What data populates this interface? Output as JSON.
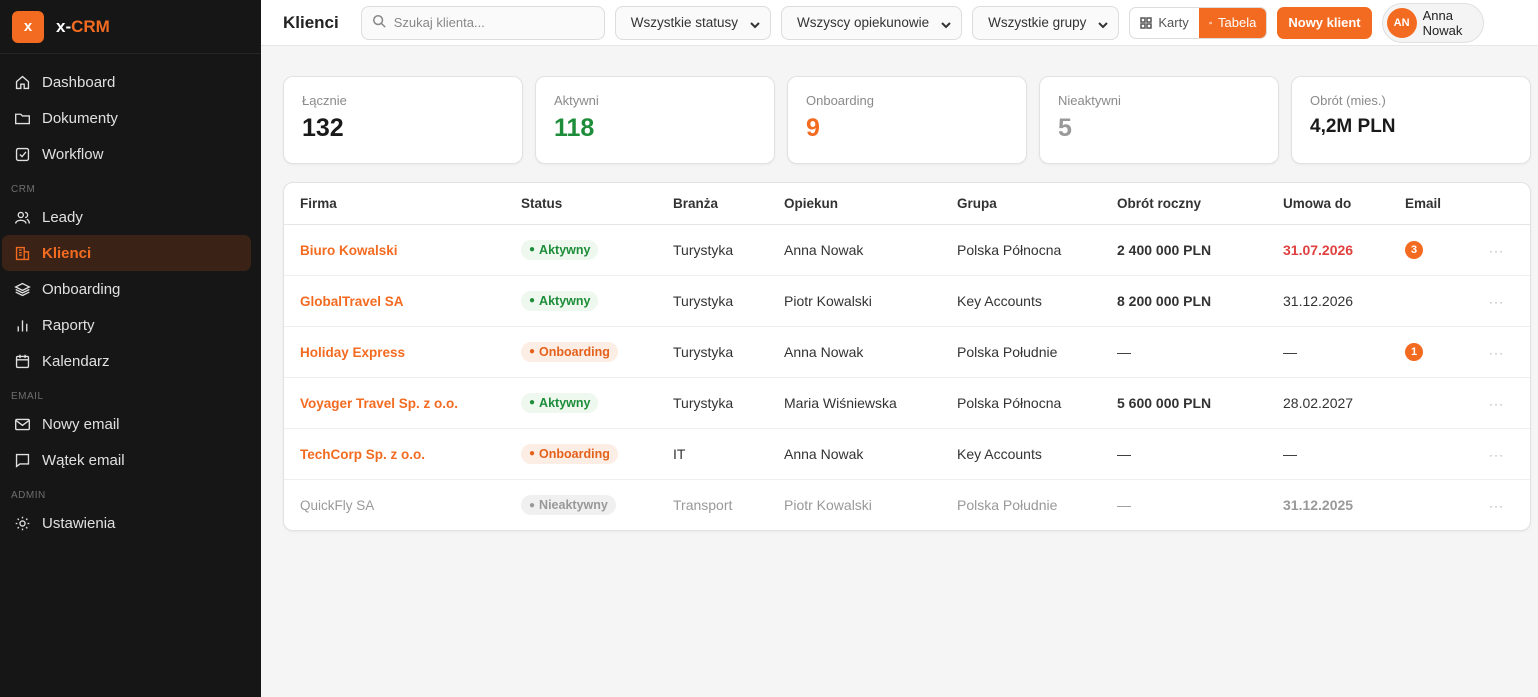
{
  "brand": {
    "logo": "x",
    "name_prefix": "x-",
    "name_accent": "CRM"
  },
  "sidebar": {
    "main_items": [
      {
        "label": "Dashboard",
        "icon": "home-icon"
      },
      {
        "label": "Dokumenty",
        "icon": "folder-icon"
      },
      {
        "label": "Workflow",
        "icon": "checkbox-icon"
      }
    ],
    "sections": {
      "crm": "CRM",
      "email": "EMAIL",
      "admin": "ADMIN"
    },
    "crm_items": [
      {
        "label": "Leady",
        "icon": "users-icon"
      },
      {
        "label": "Klienci",
        "icon": "building-icon"
      },
      {
        "label": "Onboarding",
        "icon": "layers-icon"
      },
      {
        "label": "Raporty",
        "icon": "bar-chart-icon"
      },
      {
        "label": "Kalendarz",
        "icon": "calendar-icon"
      }
    ],
    "email_items": [
      {
        "label": "Nowy email",
        "icon": "mail-icon"
      },
      {
        "label": "Wątek email",
        "icon": "message-icon"
      }
    ],
    "admin_items": [
      {
        "label": "Ustawienia",
        "icon": "gear-icon"
      }
    ]
  },
  "header": {
    "title": "Klienci",
    "search_placeholder": "Szukaj klienta...",
    "filter_status": "Wszystkie statusy",
    "filter_owner": "Wszyscy opiekunowie",
    "filter_group": "Wszystkie grupy",
    "view_cards": "Karty",
    "view_table": "Tabela",
    "new_client": "Nowy klient",
    "user_initials": "AN",
    "user_first": "Anna",
    "user_last": "Nowak"
  },
  "stats": [
    {
      "label": "Łącznie",
      "value": "132",
      "color": "#1a1a1a"
    },
    {
      "label": "Aktywni",
      "value": "118",
      "color": "#1d8d3a"
    },
    {
      "label": "Onboarding",
      "value": "9",
      "color": "#f36b21"
    },
    {
      "label": "Nieaktywni",
      "value": "5",
      "color": "#999999"
    },
    {
      "label": "Obrót (mies.)",
      "value": "4,2M PLN",
      "color": "#1a1a1a"
    }
  ],
  "table": {
    "headers": [
      "Firma",
      "Status",
      "Branża",
      "Opiekun",
      "Grupa",
      "Obrót roczny",
      "Umowa do",
      "Email",
      ""
    ],
    "rows": [
      {
        "firm": "Biuro Kowalski",
        "status": "Aktywny",
        "status_type": "green",
        "industry": "Turystyka",
        "owner": "Anna Nowak",
        "group": "Polska Północna",
        "turnover": "2 400 000 PLN",
        "contract": "31.07.2026",
        "contract_red": true,
        "email": "3"
      },
      {
        "firm": "GlobalTravel SA",
        "status": "Aktywny",
        "status_type": "green",
        "industry": "Turystyka",
        "owner": "Piotr Kowalski",
        "group": "Key Accounts",
        "turnover": "8 200 000 PLN",
        "contract": "31.12.2026",
        "contract_red": false,
        "email": ""
      },
      {
        "firm": "Holiday Express",
        "status": "Onboarding",
        "status_type": "orange",
        "industry": "Turystyka",
        "owner": "Anna Nowak",
        "group": "Polska Południe",
        "turnover": "—",
        "contract": "—",
        "contract_red": false,
        "email": "1"
      },
      {
        "firm": "Voyager Travel Sp. z o.o.",
        "status": "Aktywny",
        "status_type": "green",
        "industry": "Turystyka",
        "owner": "Maria Wiśniewska",
        "group": "Polska Północna",
        "turnover": "5 600 000 PLN",
        "contract": "28.02.2027",
        "contract_red": false,
        "email": ""
      },
      {
        "firm": "TechCorp Sp. z o.o.",
        "status": "Onboarding",
        "status_type": "orange",
        "industry": "IT",
        "owner": "Anna Nowak",
        "group": "Key Accounts",
        "turnover": "—",
        "contract": "—",
        "contract_red": false,
        "email": ""
      },
      {
        "firm": "QuickFly SA",
        "status": "Nieaktywny",
        "status_type": "gray",
        "industry": "Transport",
        "owner": "Piotr Kowalski",
        "group": "Polska Południe",
        "turnover": "—",
        "contract": "31.12.2025",
        "contract_red": true,
        "email": ""
      }
    ],
    "more_label": "···"
  }
}
